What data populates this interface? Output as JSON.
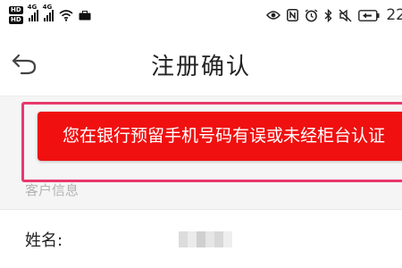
{
  "status_bar": {
    "hd_badge_1": "HD",
    "hd_badge_2": "HD",
    "signal_1_label": "4G",
    "signal_2_label": "4G",
    "time": "22",
    "icons": [
      "hd-badge",
      "signal-icon",
      "signal-icon",
      "wifi-icon",
      "briefcase-icon",
      "eye-icon",
      "nfc-icon",
      "alarm-icon",
      "bluetooth-icon",
      "mute-icon",
      "battery-icon"
    ]
  },
  "header": {
    "title": "注册确认",
    "back_icon": "back-arrow-icon"
  },
  "error": {
    "message": "您在银行预留手机号码有误或未经柜台认证",
    "banner_color": "#f01010",
    "highlight_color": "#e8386c"
  },
  "section": {
    "label": "客户信息"
  },
  "customer": {
    "name_label": "姓名:",
    "name_value_masked": true
  }
}
